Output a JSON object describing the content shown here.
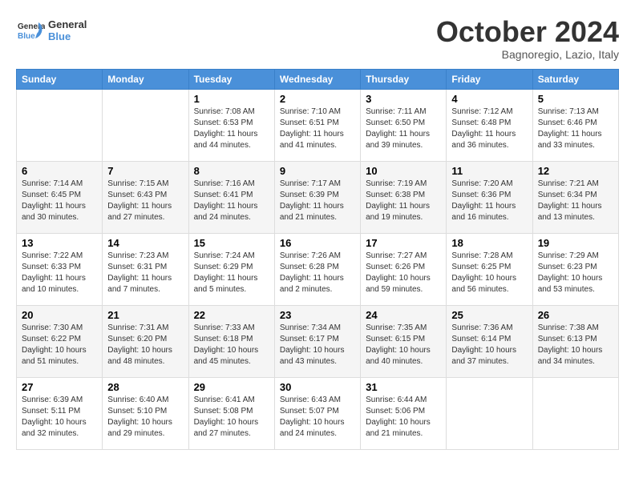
{
  "header": {
    "logo_general": "General",
    "logo_blue": "Blue",
    "month": "October 2024",
    "location": "Bagnoregio, Lazio, Italy"
  },
  "days_of_week": [
    "Sunday",
    "Monday",
    "Tuesday",
    "Wednesday",
    "Thursday",
    "Friday",
    "Saturday"
  ],
  "weeks": [
    [
      {
        "day": "",
        "info": ""
      },
      {
        "day": "",
        "info": ""
      },
      {
        "day": "1",
        "info": "Sunrise: 7:08 AM\nSunset: 6:53 PM\nDaylight: 11 hours and 44 minutes."
      },
      {
        "day": "2",
        "info": "Sunrise: 7:10 AM\nSunset: 6:51 PM\nDaylight: 11 hours and 41 minutes."
      },
      {
        "day": "3",
        "info": "Sunrise: 7:11 AM\nSunset: 6:50 PM\nDaylight: 11 hours and 39 minutes."
      },
      {
        "day": "4",
        "info": "Sunrise: 7:12 AM\nSunset: 6:48 PM\nDaylight: 11 hours and 36 minutes."
      },
      {
        "day": "5",
        "info": "Sunrise: 7:13 AM\nSunset: 6:46 PM\nDaylight: 11 hours and 33 minutes."
      }
    ],
    [
      {
        "day": "6",
        "info": "Sunrise: 7:14 AM\nSunset: 6:45 PM\nDaylight: 11 hours and 30 minutes."
      },
      {
        "day": "7",
        "info": "Sunrise: 7:15 AM\nSunset: 6:43 PM\nDaylight: 11 hours and 27 minutes."
      },
      {
        "day": "8",
        "info": "Sunrise: 7:16 AM\nSunset: 6:41 PM\nDaylight: 11 hours and 24 minutes."
      },
      {
        "day": "9",
        "info": "Sunrise: 7:17 AM\nSunset: 6:39 PM\nDaylight: 11 hours and 21 minutes."
      },
      {
        "day": "10",
        "info": "Sunrise: 7:19 AM\nSunset: 6:38 PM\nDaylight: 11 hours and 19 minutes."
      },
      {
        "day": "11",
        "info": "Sunrise: 7:20 AM\nSunset: 6:36 PM\nDaylight: 11 hours and 16 minutes."
      },
      {
        "day": "12",
        "info": "Sunrise: 7:21 AM\nSunset: 6:34 PM\nDaylight: 11 hours and 13 minutes."
      }
    ],
    [
      {
        "day": "13",
        "info": "Sunrise: 7:22 AM\nSunset: 6:33 PM\nDaylight: 11 hours and 10 minutes."
      },
      {
        "day": "14",
        "info": "Sunrise: 7:23 AM\nSunset: 6:31 PM\nDaylight: 11 hours and 7 minutes."
      },
      {
        "day": "15",
        "info": "Sunrise: 7:24 AM\nSunset: 6:29 PM\nDaylight: 11 hours and 5 minutes."
      },
      {
        "day": "16",
        "info": "Sunrise: 7:26 AM\nSunset: 6:28 PM\nDaylight: 11 hours and 2 minutes."
      },
      {
        "day": "17",
        "info": "Sunrise: 7:27 AM\nSunset: 6:26 PM\nDaylight: 10 hours and 59 minutes."
      },
      {
        "day": "18",
        "info": "Sunrise: 7:28 AM\nSunset: 6:25 PM\nDaylight: 10 hours and 56 minutes."
      },
      {
        "day": "19",
        "info": "Sunrise: 7:29 AM\nSunset: 6:23 PM\nDaylight: 10 hours and 53 minutes."
      }
    ],
    [
      {
        "day": "20",
        "info": "Sunrise: 7:30 AM\nSunset: 6:22 PM\nDaylight: 10 hours and 51 minutes."
      },
      {
        "day": "21",
        "info": "Sunrise: 7:31 AM\nSunset: 6:20 PM\nDaylight: 10 hours and 48 minutes."
      },
      {
        "day": "22",
        "info": "Sunrise: 7:33 AM\nSunset: 6:18 PM\nDaylight: 10 hours and 45 minutes."
      },
      {
        "day": "23",
        "info": "Sunrise: 7:34 AM\nSunset: 6:17 PM\nDaylight: 10 hours and 43 minutes."
      },
      {
        "day": "24",
        "info": "Sunrise: 7:35 AM\nSunset: 6:15 PM\nDaylight: 10 hours and 40 minutes."
      },
      {
        "day": "25",
        "info": "Sunrise: 7:36 AM\nSunset: 6:14 PM\nDaylight: 10 hours and 37 minutes."
      },
      {
        "day": "26",
        "info": "Sunrise: 7:38 AM\nSunset: 6:13 PM\nDaylight: 10 hours and 34 minutes."
      }
    ],
    [
      {
        "day": "27",
        "info": "Sunrise: 6:39 AM\nSunset: 5:11 PM\nDaylight: 10 hours and 32 minutes."
      },
      {
        "day": "28",
        "info": "Sunrise: 6:40 AM\nSunset: 5:10 PM\nDaylight: 10 hours and 29 minutes."
      },
      {
        "day": "29",
        "info": "Sunrise: 6:41 AM\nSunset: 5:08 PM\nDaylight: 10 hours and 27 minutes."
      },
      {
        "day": "30",
        "info": "Sunrise: 6:43 AM\nSunset: 5:07 PM\nDaylight: 10 hours and 24 minutes."
      },
      {
        "day": "31",
        "info": "Sunrise: 6:44 AM\nSunset: 5:06 PM\nDaylight: 10 hours and 21 minutes."
      },
      {
        "day": "",
        "info": ""
      },
      {
        "day": "",
        "info": ""
      }
    ]
  ]
}
